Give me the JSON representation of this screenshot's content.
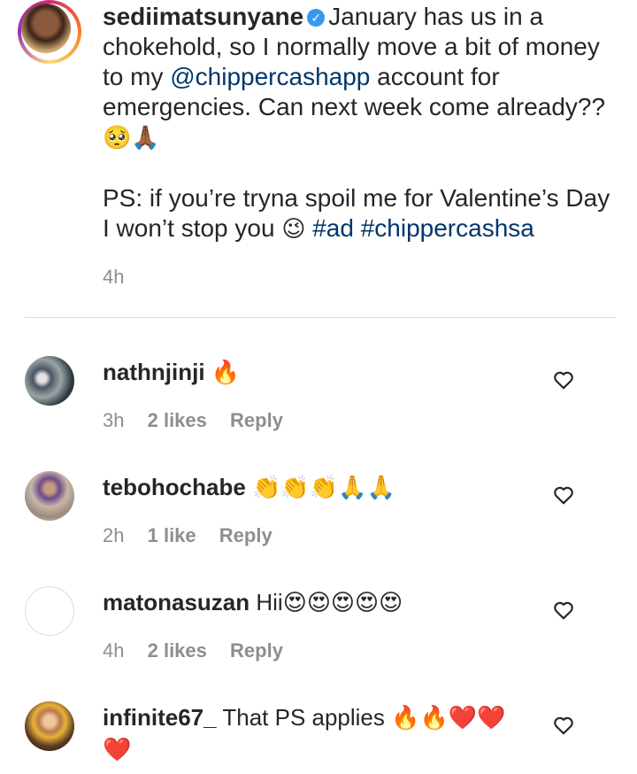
{
  "post": {
    "username": "sediimatsunyane",
    "caption_part1": "January has us in a chokehold, so I normally move a bit of money to my ",
    "mention": "@chippercashapp",
    "caption_part2": " account for emergencies. Can next week come already?? ",
    "caption_emoji1": "🥺🙏🏾",
    "caption_part3": "\n\nPS: if you’re tryna spoil me for Valentine’s Day I won’t stop you ",
    "caption_emoji2": "😉",
    "hashtags": " #ad #chippercashsa",
    "time": "4h"
  },
  "comments": [
    {
      "username": "nathnjinji",
      "text": " 🔥",
      "time": "3h",
      "likes": "2 likes",
      "reply": "Reply"
    },
    {
      "username": "tebohochabe",
      "text": " 👏👏👏🙏🙏",
      "time": "2h",
      "likes": "1 like",
      "reply": "Reply"
    },
    {
      "username": "matonasuzan",
      "text": " Hii😍😍😍😍😍",
      "time": "4h",
      "likes": "2 likes",
      "reply": "Reply"
    },
    {
      "username": "infinite67_",
      "text": " That PS applies 🔥🔥❤️❤️\n❤️",
      "time": "",
      "likes": "",
      "reply": ""
    }
  ],
  "colors": {
    "text": "#262626",
    "muted": "#8e8e8e",
    "link": "#00376b",
    "verified": "#3897f0",
    "divider": "#dbdbdb"
  },
  "icons": {
    "verified": "verified-badge-icon",
    "like": "heart-outline-icon"
  }
}
